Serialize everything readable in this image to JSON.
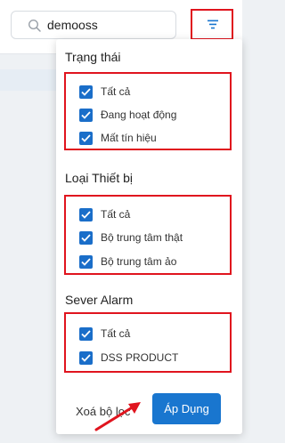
{
  "search": {
    "value": "demooss",
    "icon": "search-icon"
  },
  "filter_button": {
    "icon": "filter-icon"
  },
  "filter_panel": {
    "sections": [
      {
        "title": "Trạng thái",
        "options": [
          {
            "label": "Tất cả",
            "checked": true
          },
          {
            "label": "Đang hoạt động",
            "checked": true
          },
          {
            "label": "Mất tín hiệu",
            "checked": true
          }
        ]
      },
      {
        "title": "Loại Thiết bị",
        "options": [
          {
            "label": "Tất cả",
            "checked": true
          },
          {
            "label": "Bộ trung tâm thật",
            "checked": true
          },
          {
            "label": "Bộ trung tâm ảo",
            "checked": true
          }
        ]
      },
      {
        "title": "Sever Alarm",
        "options": [
          {
            "label": "Tất cả",
            "checked": true
          },
          {
            "label": "DSS PRODUCT",
            "checked": true
          }
        ]
      }
    ],
    "clear_label": "Xoá bộ lọc",
    "apply_label": "Áp Dụng"
  },
  "colors": {
    "accent": "#1976cf",
    "checkbox": "#1a6ec9",
    "highlight": "#e0141e"
  }
}
